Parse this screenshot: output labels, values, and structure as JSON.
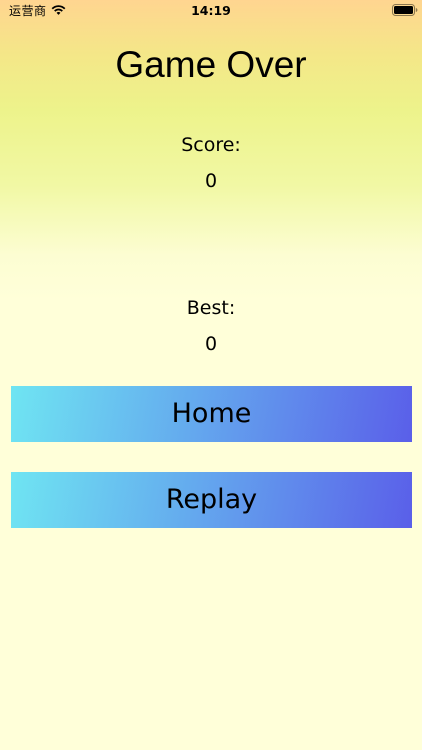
{
  "status_bar": {
    "carrier": "运营商",
    "time": "14:19",
    "wifi_icon": "wifi-icon",
    "battery_icon": "battery-icon"
  },
  "screen": {
    "title": "Game Over",
    "score_label": "Score:",
    "score_value": "0",
    "best_label": "Best:",
    "best_value": "0"
  },
  "buttons": {
    "home_label": "Home",
    "replay_label": "Replay"
  },
  "colors": {
    "background_top": "#ffd590",
    "background_middle": "#edf38b",
    "background_bottom": "#ffffd9",
    "button_gradient_start": "#6fe5f2",
    "button_gradient_end": "#5a5fe9"
  }
}
